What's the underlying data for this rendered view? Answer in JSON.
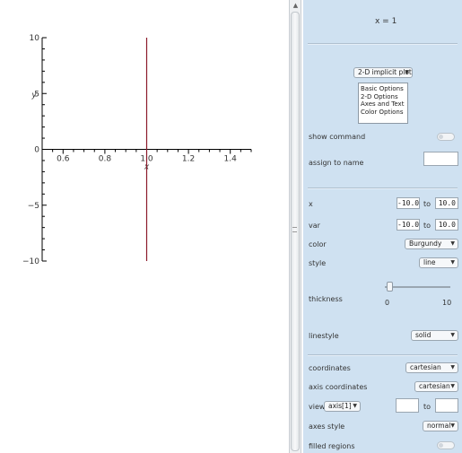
{
  "chart_data": {
    "type": "line",
    "title": "",
    "xlabel": "x",
    "ylabel": "y",
    "xlim": [
      0.5,
      1.5
    ],
    "ylim": [
      -10,
      10
    ],
    "x_ticks": [
      "0.6",
      "0.8",
      "1.0",
      "1.2",
      "1.4"
    ],
    "y_ticks": [
      "10",
      "5",
      "0",
      "−5",
      "−10"
    ],
    "series": [
      {
        "x": [
          1,
          1
        ],
        "y": [
          -10,
          10
        ],
        "color": "#8b1a2b"
      }
    ],
    "grid": false
  },
  "panel": {
    "expression": "x = 1",
    "plot_type": "2-D implicit plot",
    "options_list": [
      "Basic Options",
      "2-D Options",
      "Axes and Text",
      "Color Options"
    ],
    "show_command_label": "show command",
    "assign_label": "assign to name",
    "x_label": "x",
    "x_from": "-10.0",
    "x_to": "10.0",
    "var_label": "var",
    "var_from": "-10.0",
    "var_to": "10.0",
    "to_label": "to",
    "color_label": "color",
    "color_value": "Burgundy",
    "style_label": "style",
    "style_value": "line",
    "thickness_label": "thickness",
    "thickness_min": "0",
    "thickness_max": "10",
    "thickness_value": 0.07,
    "linestyle_label": "linestyle",
    "linestyle_value": "solid",
    "coordinates_label": "coordinates",
    "coordinates_value": "cartesian",
    "axis_coordinates_label": "axis coordinates",
    "axis_coordinates_value": "cartesian",
    "view_label": "view",
    "view_value": "axis[1]",
    "axes_style_label": "axes style",
    "axes_style_value": "normal",
    "filled_regions_label": "filled regions"
  },
  "colors": {
    "panel_bg": "#cfe1f1",
    "curve": "#8b1a2b"
  }
}
